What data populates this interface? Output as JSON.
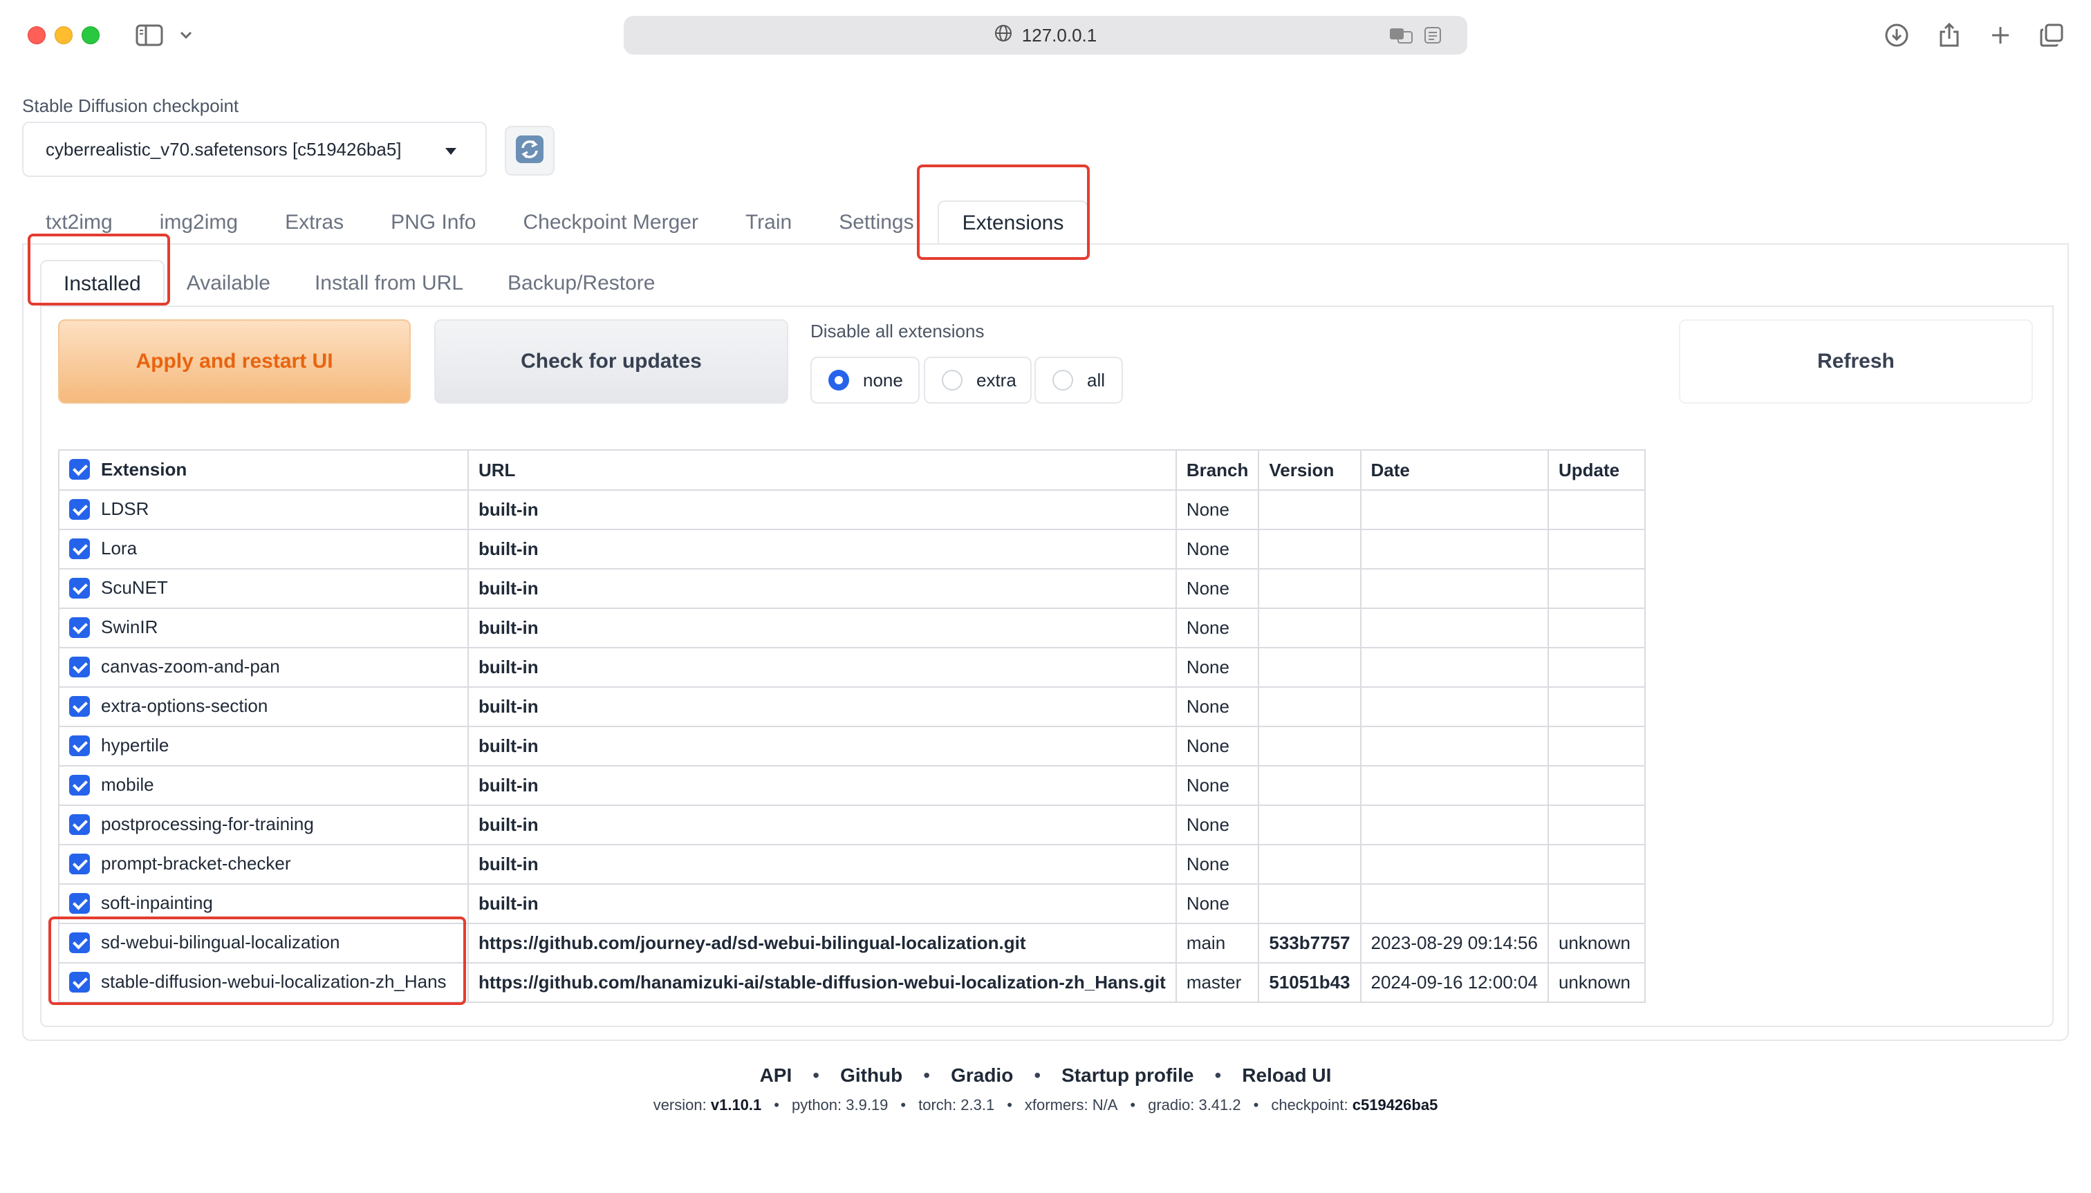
{
  "browser": {
    "address": "127.0.0.1"
  },
  "checkpoint": {
    "label": "Stable Diffusion checkpoint",
    "value": "cyberrealistic_v70.safetensors [c519426ba5]"
  },
  "tabs": [
    "txt2img",
    "img2img",
    "Extras",
    "PNG Info",
    "Checkpoint Merger",
    "Train",
    "Settings",
    "Extensions"
  ],
  "subtabs": [
    "Installed",
    "Available",
    "Install from URL",
    "Backup/Restore"
  ],
  "actions": {
    "apply": "Apply and restart UI",
    "check": "Check for updates",
    "refresh": "Refresh"
  },
  "disable": {
    "label": "Disable all extensions",
    "options": [
      "none",
      "extra",
      "all"
    ],
    "selected": "none"
  },
  "table": {
    "headers": [
      "Extension",
      "URL",
      "Branch",
      "Version",
      "Date",
      "Update"
    ],
    "rows": [
      [
        "LDSR",
        "built-in",
        "None",
        "",
        "",
        ""
      ],
      [
        "Lora",
        "built-in",
        "None",
        "",
        "",
        ""
      ],
      [
        "ScuNET",
        "built-in",
        "None",
        "",
        "",
        ""
      ],
      [
        "SwinIR",
        "built-in",
        "None",
        "",
        "",
        ""
      ],
      [
        "canvas-zoom-and-pan",
        "built-in",
        "None",
        "",
        "",
        ""
      ],
      [
        "extra-options-section",
        "built-in",
        "None",
        "",
        "",
        ""
      ],
      [
        "hypertile",
        "built-in",
        "None",
        "",
        "",
        ""
      ],
      [
        "mobile",
        "built-in",
        "None",
        "",
        "",
        ""
      ],
      [
        "postprocessing-for-training",
        "built-in",
        "None",
        "",
        "",
        ""
      ],
      [
        "prompt-bracket-checker",
        "built-in",
        "None",
        "",
        "",
        ""
      ],
      [
        "soft-inpainting",
        "built-in",
        "None",
        "",
        "",
        ""
      ],
      [
        "sd-webui-bilingual-localization",
        "https://github.com/journey-ad/sd-webui-bilingual-localization.git",
        "main",
        "533b7757",
        "2023-08-29 09:14:56",
        "unknown"
      ],
      [
        "stable-diffusion-webui-localization-zh_Hans",
        "https://github.com/hanamizuki-ai/stable-diffusion-webui-localization-zh_Hans.git",
        "master",
        "51051b43",
        "2024-09-16 12:00:04",
        "unknown"
      ]
    ]
  },
  "footer": {
    "links": [
      "API",
      "Github",
      "Gradio",
      "Startup profile",
      "Reload UI"
    ],
    "version_label": "version:",
    "version": "v1.10.1",
    "python": "python: 3.9.19",
    "torch": "torch: 2.3.1",
    "xformers": "xformers: N/A",
    "gradio": "gradio: 3.41.2",
    "checkpoint_label": "checkpoint:",
    "checkpoint": "c519426ba5"
  },
  "colors": {
    "accent": "#2563eb",
    "primary_text": "#e8640f",
    "annotation": "#e43d30"
  }
}
